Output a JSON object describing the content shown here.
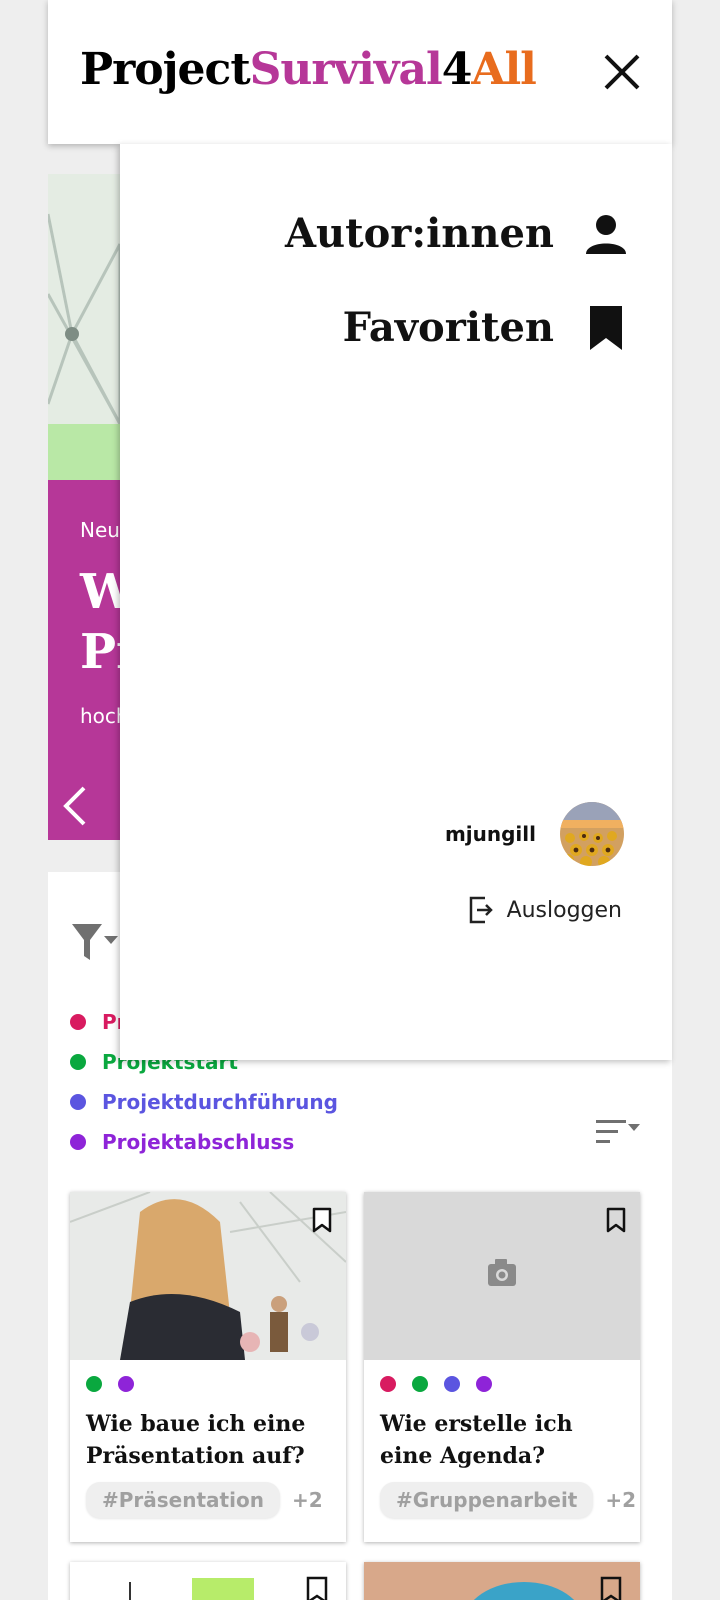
{
  "header": {
    "logo": {
      "part1": "Project",
      "part2": "Survival",
      "part3": "4",
      "part4": "All"
    },
    "close_icon": "close-icon"
  },
  "hero": {
    "kicker": "Neu",
    "title_line1": "W",
    "title_line2": "Pr",
    "subtitle": "hoch"
  },
  "drawer": {
    "items": [
      {
        "label": "Autor:innen",
        "icon": "person-icon"
      },
      {
        "label": "Favoriten",
        "icon": "bookmark-icon"
      }
    ],
    "user": {
      "name": "mjungill"
    },
    "logout_label": "Ausloggen"
  },
  "filters": {
    "categories": [
      {
        "label": "Pr",
        "color": "#d81b60"
      },
      {
        "label": "Projektstart",
        "color": "#0aa83f"
      },
      {
        "label": "Projektdurchführung",
        "color": "#5b55e0"
      },
      {
        "label": "Projektabschluss",
        "color": "#8e24d8"
      }
    ]
  },
  "cards": [
    {
      "title": "Wie baue ich eine Präsentation auf?",
      "tag": "#Präsentation",
      "more": "+2",
      "dot_colors": [
        "#0aa83f",
        "#8e24d8"
      ]
    },
    {
      "title": "Wie erstelle ich eine Agenda?",
      "tag": "#Gruppenarbeit",
      "more": "+2",
      "dot_colors": [
        "#d81b60",
        "#0aa83f",
        "#5b55e0",
        "#8e24d8"
      ]
    }
  ],
  "colors": {
    "brand_pink": "#b63798",
    "brand_orange": "#e86c1e"
  }
}
